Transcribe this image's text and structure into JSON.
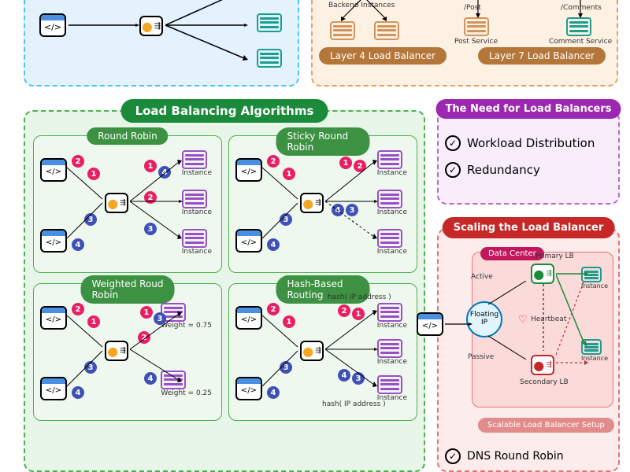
{
  "top_right": {
    "backend_label": "Backend Instances",
    "layer4": "Layer 4 Load Balancer",
    "layer7": "Layer 7 Load Balancer",
    "post": "/Post",
    "comments": "/Comments",
    "post_service": "Post Service",
    "comment_service": "Comment Service"
  },
  "algorithms": {
    "title": "Load Balancing Algorithms",
    "round_robin": "Round Robin",
    "sticky": "Sticky Round Robin",
    "weighted": "Weighted Roud Robin",
    "hash": "Hash-Based Routing",
    "instance": "Instance",
    "weight_75": "Weight = 0.75",
    "weight_25": "Weight = 0.25",
    "hash_ip": "hash( IP address )"
  },
  "need": {
    "title": "The Need for Load Balancers",
    "item1": "Workload Distribution",
    "item2": "Redundancy"
  },
  "scaling": {
    "title": "Scaling the Load Balancer",
    "data_center": "Data Center",
    "primary": "Primary LB",
    "secondary": "Secondary LB",
    "active": "Active",
    "passive": "Passive",
    "floating": "Floating IP",
    "heartbeat": "Heartbeat",
    "instance": "Instance",
    "setup": "Scalable Load Balancer Setup",
    "dns": "DNS Round Robin"
  }
}
